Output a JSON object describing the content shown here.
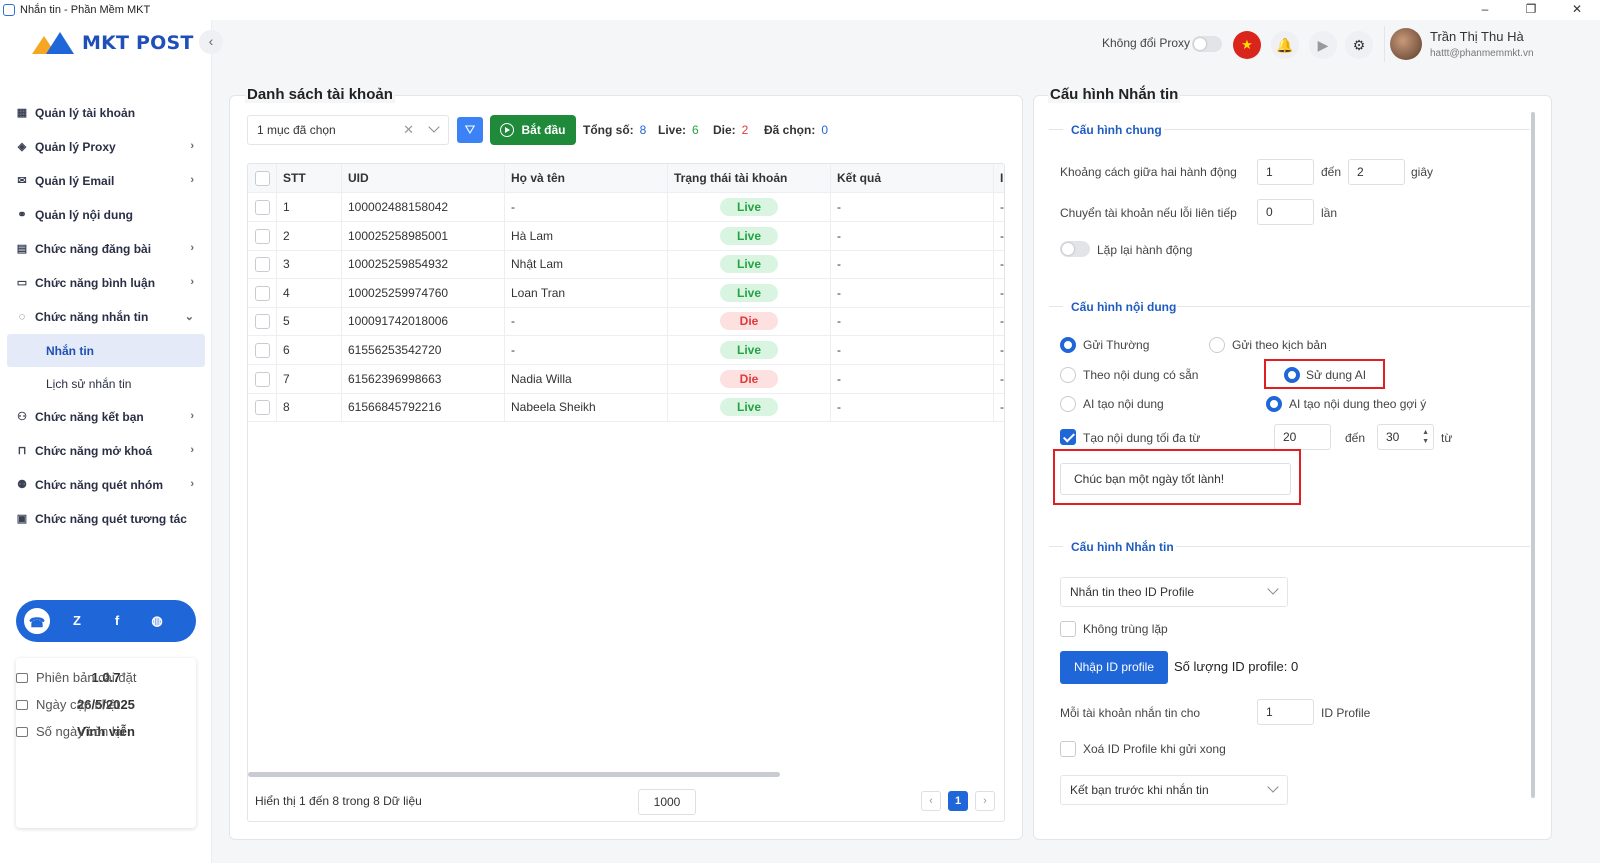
{
  "window": {
    "title": "Nhắn tin - Phần Mềm MKT",
    "minimize": "–",
    "restore": "❐",
    "close": "✕"
  },
  "brand": {
    "name": "MKT POST"
  },
  "sidebar": {
    "collapse_icon": "‹",
    "items": [
      {
        "label": "Quản lý tài khoản",
        "icon": "grid-icon",
        "glyph": "▦",
        "chevron": ""
      },
      {
        "label": "Quản lý Proxy",
        "icon": "layers-icon",
        "glyph": "◈",
        "chevron": "›"
      },
      {
        "label": "Quản lý Email",
        "icon": "mail-icon",
        "glyph": "✉",
        "chevron": "›"
      },
      {
        "label": "Quản lý nội dung",
        "icon": "link-icon",
        "glyph": "⚭",
        "chevron": ""
      },
      {
        "label": "Chức năng đăng bài",
        "icon": "post-icon",
        "glyph": "▤",
        "chevron": "›"
      },
      {
        "label": "Chức năng bình luận",
        "icon": "comment-icon",
        "glyph": "▭",
        "chevron": "›"
      },
      {
        "label": "Chức năng nhắn tin",
        "icon": "message-icon",
        "glyph": "◌",
        "chevron": "⌄"
      }
    ],
    "subitems": [
      {
        "label": "Nhắn tin",
        "active": true
      },
      {
        "label": "Lịch sử nhắn tin",
        "active": false
      }
    ],
    "items2": [
      {
        "label": "Chức năng kết bạn",
        "icon": "add-friend-icon",
        "glyph": "⚇",
        "chevron": "›"
      },
      {
        "label": "Chức năng mở khoá",
        "icon": "lock-icon",
        "glyph": "⊓",
        "chevron": "›"
      },
      {
        "label": "Chức năng quét nhóm",
        "icon": "group-icon",
        "glyph": "⚉",
        "chevron": "›"
      },
      {
        "label": "Chức năng quét tương tác",
        "icon": "scan-icon",
        "glyph": "▣",
        "chevron": ""
      }
    ],
    "social": [
      {
        "name": "support-icon",
        "glyph": "☎"
      },
      {
        "name": "zalo-icon",
        "glyph": "Z"
      },
      {
        "name": "facebook-icon",
        "glyph": "f"
      },
      {
        "name": "globe-icon",
        "glyph": "◍"
      }
    ],
    "info": {
      "version_label": "Phiên bản cài đặt",
      "version": "1.0.7",
      "updated_label": "Ngày cập nhật",
      "updated": "26/5/2025",
      "days_label": "Số ngày còn lại",
      "days": "Vĩnh viễn"
    }
  },
  "header": {
    "proxy_label": "Không đổi Proxy",
    "flag_icon": "★",
    "bell_icon": "🔔",
    "play_icon": "▶",
    "gear_icon": "⚙",
    "user_name": "Trần Thị Thu Hà",
    "user_email": "hattt@phanmemmkt.vn"
  },
  "accounts": {
    "title": "Danh sách tài khoản",
    "select_value": "1 mục đã chọn",
    "clear_icon": "✕",
    "filter_icon": "⛛",
    "start_label": "Bắt đầu",
    "total_label": "Tổng số:",
    "total": "8",
    "live_label": "Live:",
    "live": "6",
    "die_label": "Die:",
    "die": "2",
    "selected_label": "Đã chọn:",
    "selected": "0",
    "columns": [
      "STT",
      "UID",
      "Họ và tên",
      "Trạng thái tài khoản",
      "Kết quả",
      "I"
    ],
    "rows": [
      {
        "stt": "1",
        "uid": "100002488158042",
        "name": "-",
        "status": "Live",
        "result": "-",
        "extra": "-"
      },
      {
        "stt": "2",
        "uid": "100025258985001",
        "name": "Hà Lam",
        "status": "Live",
        "result": "-",
        "extra": "-"
      },
      {
        "stt": "3",
        "uid": "100025259854932",
        "name": "Nhật Lam",
        "status": "Live",
        "result": "-",
        "extra": "-"
      },
      {
        "stt": "4",
        "uid": "100025259974760",
        "name": "Loan Tran",
        "status": "Live",
        "result": "-",
        "extra": "-"
      },
      {
        "stt": "5",
        "uid": "100091742018006",
        "name": "-",
        "status": "Die",
        "result": "-",
        "extra": "-"
      },
      {
        "stt": "6",
        "uid": "61556253542720",
        "name": "-",
        "status": "Live",
        "result": "-",
        "extra": "-"
      },
      {
        "stt": "7",
        "uid": "61562396998663",
        "name": "Nadia Willa",
        "status": "Die",
        "result": "-",
        "extra": "-"
      },
      {
        "stt": "8",
        "uid": "61566845792216",
        "name": "Nabeela Sheikh",
        "status": "Live",
        "result": "-",
        "extra": "-"
      }
    ],
    "footer_text": "Hiển thị 1 đến 8 trong 8 Dữ liệu",
    "page_size": "1000",
    "page_prev": "‹",
    "page_current": "1",
    "page_next": "›"
  },
  "config": {
    "title": "Cấu hình Nhắn tin",
    "general": {
      "title": "Cấu hình chung",
      "delay_label": "Khoảng cách giữa hai hành động",
      "delay_from": "1",
      "to_label": "đến",
      "delay_to": "2",
      "unit_sec": "giây",
      "switch_label": "Chuyển tài khoản nếu lỗi liên tiếp",
      "switch_value": "0",
      "unit_times": "lần",
      "repeat_label": "Lặp lại hành động"
    },
    "content": {
      "title": "Cấu hình nội dung",
      "opt_normal": "Gửi Thường",
      "opt_script": "Gửi theo kịch bản",
      "opt_existing": "Theo nội dung có sẵn",
      "opt_ai": "Sử dụng AI",
      "opt_ai_create": "AI tạo nội dung",
      "opt_ai_prompt": "AI tạo nội dung theo gợi ý",
      "max_label": "Tạo nội dung tối đa từ",
      "max_from": "20",
      "max_to_label": "đến",
      "max_to": "30",
      "max_unit": "từ",
      "prompt_text": "Chúc bạn một ngày tốt lành!"
    },
    "messaging": {
      "title": "Cấu hình Nhắn tin",
      "mode_value": "Nhắn tin theo ID Profile",
      "no_dup_label": "Không trùng lặp",
      "import_button": "Nhập ID profile",
      "count_label": "Số lượng ID profile: 0",
      "per_acc_label": "Mỗi tài khoản nhắn tin cho",
      "per_acc_value": "1",
      "per_acc_unit": "ID Profile",
      "delete_label": "Xoá ID Profile khi gửi xong",
      "friend_value": "Kết bạn trước khi nhắn tin"
    }
  }
}
